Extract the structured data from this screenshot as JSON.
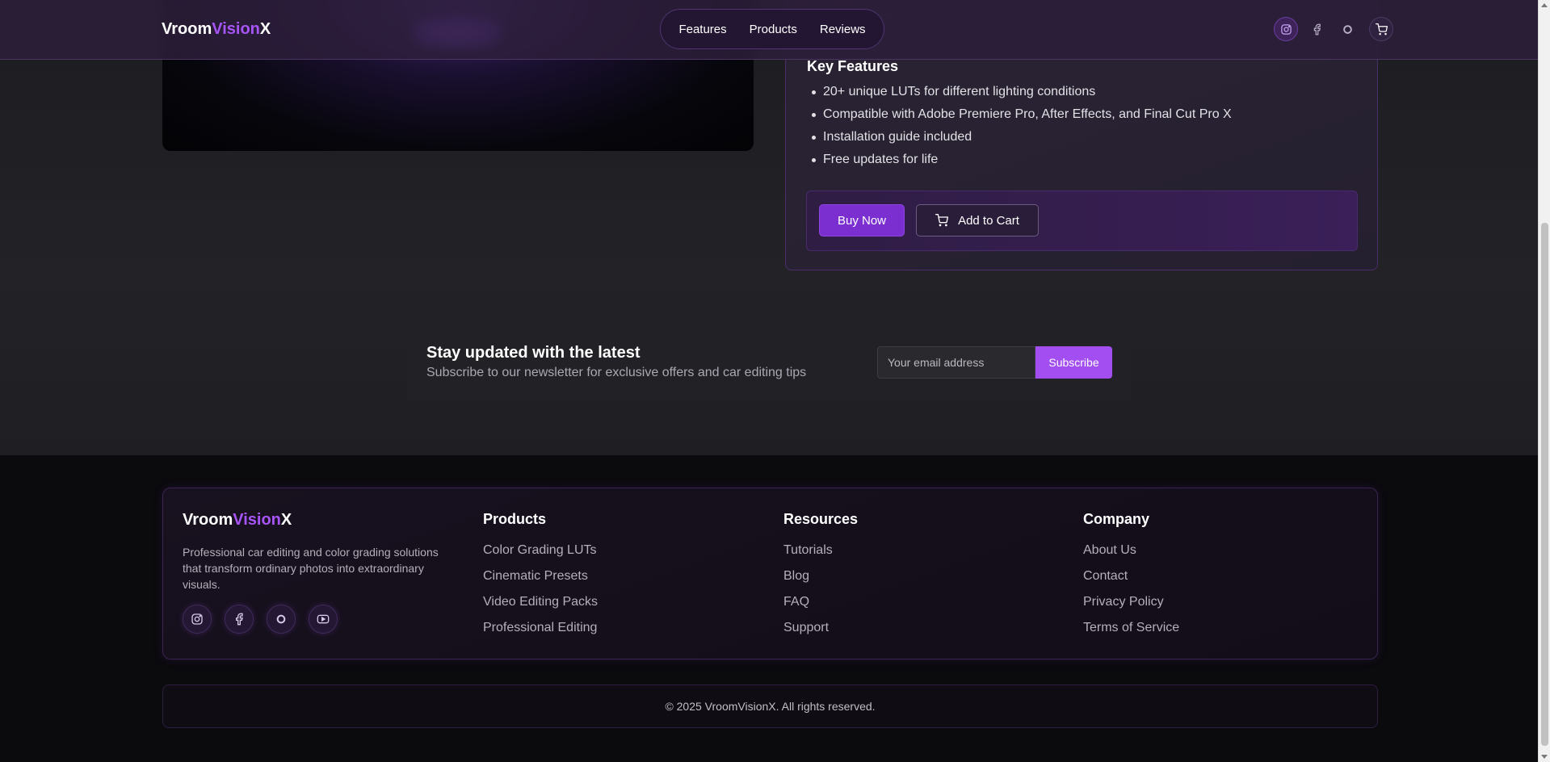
{
  "header": {
    "logo": {
      "part1": "Vroom",
      "part2": "Vision",
      "part3": "X"
    },
    "nav": [
      {
        "label": "Features"
      },
      {
        "label": "Products"
      },
      {
        "label": "Reviews"
      }
    ],
    "icons": [
      "instagram-icon",
      "facebook-icon",
      "threads-icon",
      "cart-icon"
    ]
  },
  "product": {
    "features_title": "Key Features",
    "features": [
      "20+ unique LUTs for different lighting conditions",
      "Compatible with Adobe Premiere Pro, After Effects, and Final Cut Pro X",
      "Installation guide included",
      "Free updates for life"
    ],
    "buy_label": "Buy Now",
    "cart_label": "Add to Cart"
  },
  "newsletter": {
    "title": "Stay updated with the latest",
    "subtitle": "Subscribe to our newsletter for exclusive offers and car editing tips",
    "email_placeholder": "Your email address",
    "subscribe_label": "Subscribe"
  },
  "footer": {
    "logo": {
      "part1": "Vroom",
      "part2": "Vision",
      "part3": "X"
    },
    "description": "Professional car editing and color grading solutions that transform ordinary photos into extraordinary visuals.",
    "social_icons": [
      "instagram-icon",
      "facebook-icon",
      "threads-icon",
      "youtube-icon"
    ],
    "columns": [
      {
        "title": "Products",
        "links": [
          "Color Grading LUTs",
          "Cinematic Presets",
          "Video Editing Packs",
          "Professional Editing"
        ]
      },
      {
        "title": "Resources",
        "links": [
          "Tutorials",
          "Blog",
          "FAQ",
          "Support"
        ]
      },
      {
        "title": "Company",
        "links": [
          "About Us",
          "Contact",
          "Privacy Policy",
          "Terms of Service"
        ]
      }
    ],
    "copyright": "© 2025 VroomVisionX. All rights reserved."
  },
  "colors": {
    "accent": "#a855f7",
    "button_primary": "#7b2fd0",
    "subscribe": "#a24ef0",
    "background": "#1e1e22",
    "footer_bg": "#0b0a0d"
  }
}
